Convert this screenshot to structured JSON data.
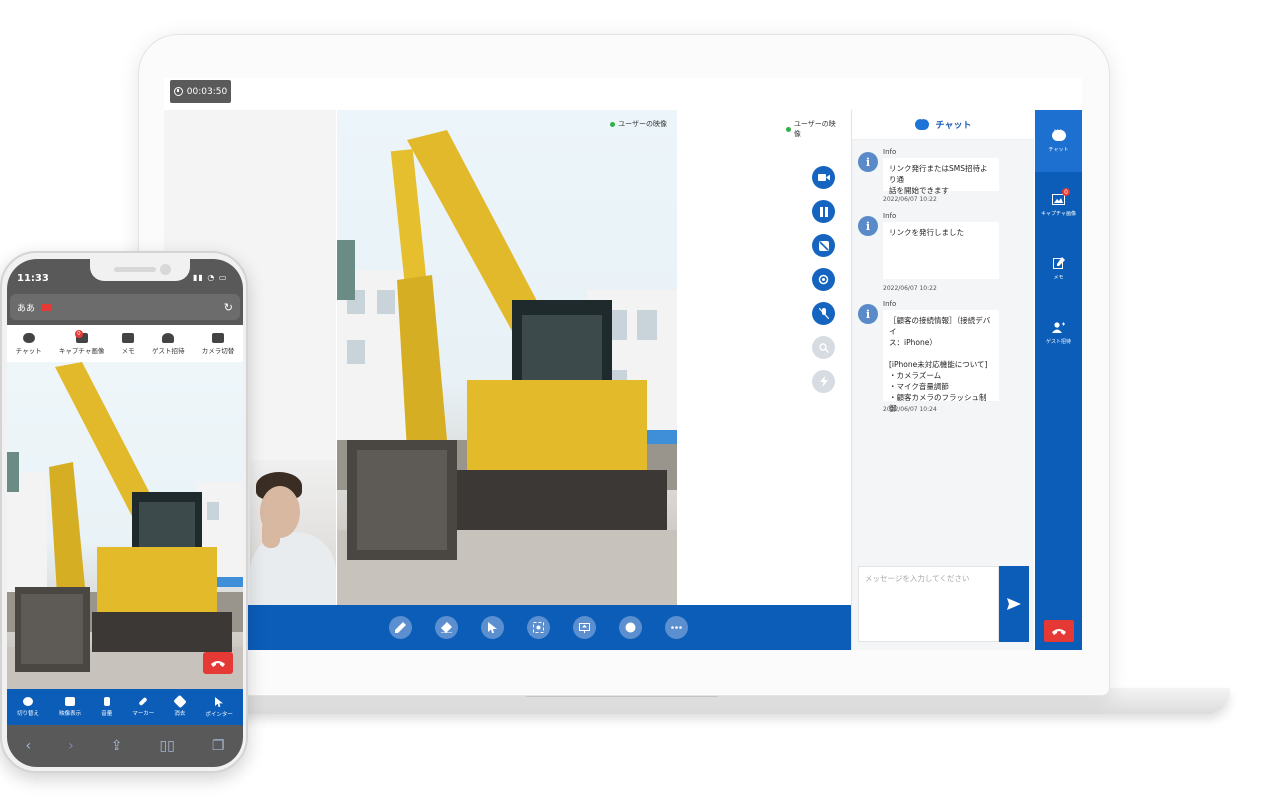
{
  "laptop": {
    "timer": "00:03:50",
    "user_video_label": "ユーザーの映像",
    "chat": {
      "header": "チャット",
      "messages": [
        {
          "sender": "Info",
          "body": "リンク発行またはSMS招待より通\n話を開始できます",
          "time": "2022/06/07 10:22"
        },
        {
          "sender": "Info",
          "body": "リンクを発行しました",
          "time": "2022/06/07 10:22"
        },
        {
          "sender": "Info",
          "body": "［顧客の接続情報］（接続デバイ\nス：iPhone）\n\n[iPhone未対応機能について]\n・カメラズーム\n・マイク音量調節\n・顧客カメラのフラッシュ制御",
          "time": "2022/06/07 10:24"
        }
      ],
      "input_placeholder": "メッセージを入力してください"
    },
    "rail": [
      {
        "label": "チャット",
        "icon": "chat-icon"
      },
      {
        "label": "キャプチャ画像",
        "icon": "image-icon",
        "badge": "0"
      },
      {
        "label": "メモ",
        "icon": "memo-icon"
      },
      {
        "label": "ゲスト招待",
        "icon": "add-user-icon"
      }
    ]
  },
  "phone": {
    "time": "11:33",
    "url_text": "ああ",
    "tabs": [
      {
        "label": "チャット"
      },
      {
        "label": "キャプチャ画像",
        "badge": "0"
      },
      {
        "label": "メモ"
      },
      {
        "label": "ゲスト招待"
      },
      {
        "label": "カメラ切替"
      }
    ],
    "tools": [
      {
        "label": "切り替え"
      },
      {
        "label": "映像表示"
      },
      {
        "label": "音量"
      },
      {
        "label": "マーカー"
      },
      {
        "label": "消去"
      },
      {
        "label": "ポインター"
      }
    ]
  },
  "colors": {
    "primary": "#0b5db8",
    "accent": "#1565c0",
    "danger": "#e53935"
  }
}
